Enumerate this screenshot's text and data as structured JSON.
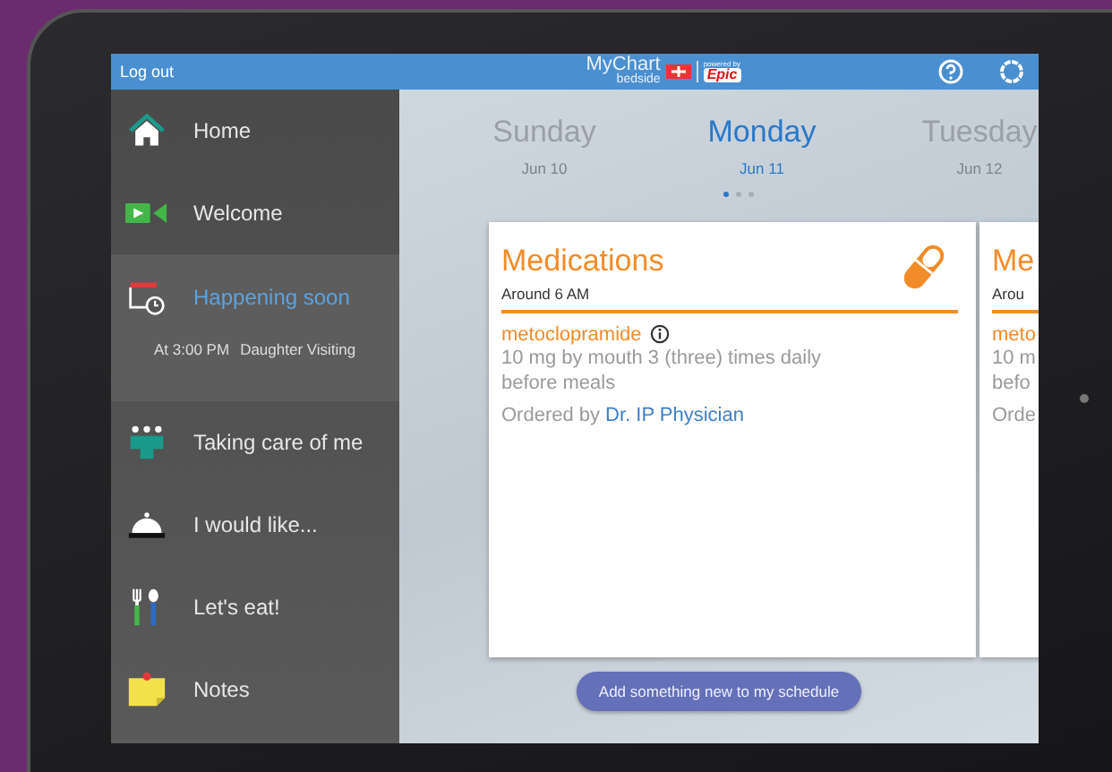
{
  "top_bar": {
    "logout": "Log out",
    "logo": {
      "name": "MyChart",
      "sub": "bedside",
      "powered": "powered by",
      "brand": "Epic"
    }
  },
  "sidebar": {
    "items": [
      {
        "kind": "home",
        "label": "Home",
        "selected": false
      },
      {
        "kind": "video",
        "label": "Welcome",
        "selected": false
      },
      {
        "kind": "calendar",
        "label": "Happening soon",
        "selected": true,
        "detail_time": "At 3:00 PM",
        "detail_text": "Daughter Visiting"
      },
      {
        "kind": "team",
        "label": "Taking care of me",
        "selected": false
      },
      {
        "kind": "bell",
        "label": "I would like...",
        "selected": false
      },
      {
        "kind": "food",
        "label": "Let's eat!",
        "selected": false
      },
      {
        "kind": "note",
        "label": "Notes",
        "selected": false
      }
    ]
  },
  "days": [
    {
      "name": "Sunday",
      "date": "Jun 10",
      "selected": false
    },
    {
      "name": "Monday",
      "date": "Jun 11",
      "selected": true
    },
    {
      "name": "Tuesday",
      "date": "Jun 12",
      "selected": false
    }
  ],
  "pages": [
    {
      "selected": true
    },
    {
      "selected": false
    },
    {
      "selected": false
    }
  ],
  "cards": [
    {
      "title": "Medications",
      "time": "Around 6 AM",
      "medication": "metoclopramide",
      "info": true,
      "instructions": [
        "10 mg by mouth 3 (three) times daily",
        "before meals"
      ],
      "ordered_by": "Ordered by",
      "doctor": "Dr. IP Physician"
    },
    {
      "title": "Me",
      "time": "Arou",
      "medication": "meto",
      "info": false,
      "instructions": [
        "10 m",
        "befo"
      ],
      "ordered_by": "Orde"
    }
  ],
  "add_button": "Add something new to my schedule"
}
